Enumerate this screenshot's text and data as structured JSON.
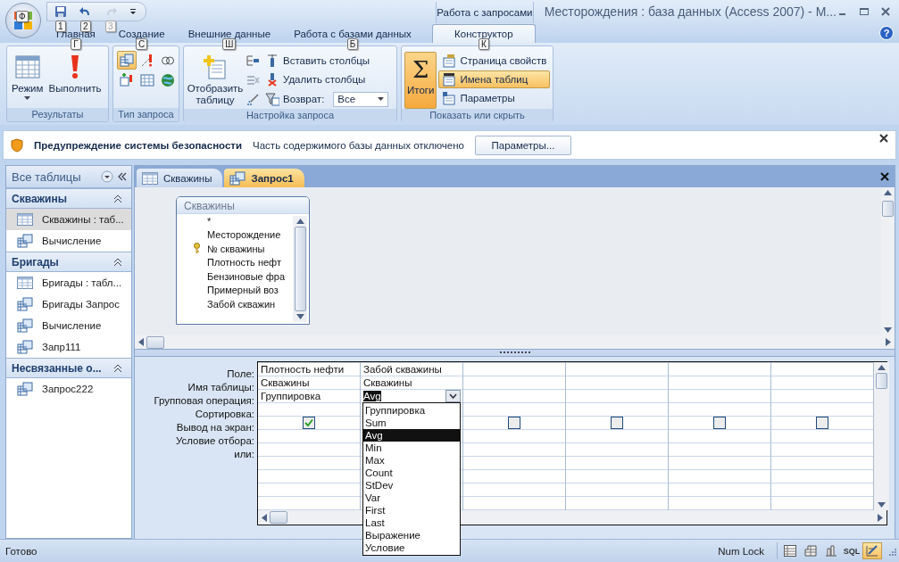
{
  "window": {
    "title": "Месторождения : база данных (Access 2007) - M...",
    "context_tab": "Работа с запросами",
    "help": "?"
  },
  "office_button": {
    "keytip": "Ф"
  },
  "quick_access": [
    {
      "keytip": "1",
      "disabled": false
    },
    {
      "keytip": "2",
      "disabled": false
    },
    {
      "keytip": "3",
      "disabled": true
    }
  ],
  "ribbon_tabs": [
    {
      "label": "Главная",
      "keytip": "Г",
      "selected": false
    },
    {
      "label": "Создание",
      "keytip": "С",
      "selected": false
    },
    {
      "label": "Внешние данные",
      "keytip": "Ш",
      "selected": false
    },
    {
      "label": "Работа с базами данных",
      "keytip": "Б",
      "selected": false
    },
    {
      "label": "Конструктор",
      "keytip": "К",
      "selected": true
    }
  ],
  "ribbon": {
    "results": {
      "label": "Результаты",
      "view": "Режим",
      "run": "Выполнить"
    },
    "query_type": {
      "label": "Тип запроса",
      "buttons": [
        {
          "selected": true
        },
        {
          "selected": false
        },
        {
          "selected": false
        },
        {
          "selected": false
        },
        {
          "selected": false
        },
        {
          "selected": false
        }
      ]
    },
    "query_setup": {
      "label": "Настройка запроса",
      "show_table": "Отобразить таблицу",
      "insert_columns": "Вставить столбцы",
      "delete_columns": "Удалить столбцы",
      "return_label": "Возврат:",
      "return_value": "Все"
    },
    "show_hide": {
      "label": "Показать или скрыть",
      "totals": {
        "symbol": "Σ",
        "label": "Итоги",
        "selected": true
      },
      "items": [
        {
          "label": "Страница свойств",
          "selected": false
        },
        {
          "label": "Имена таблиц",
          "selected": true
        },
        {
          "label": "Параметры",
          "selected": false
        }
      ]
    }
  },
  "security_bar": {
    "title": "Предупреждение системы безопасности",
    "message": "Часть содержимого базы данных отключено",
    "button": "Параметры..."
  },
  "navigation": {
    "header": "Все таблицы",
    "groups": [
      {
        "label": "Скважины",
        "items": [
          {
            "label": "Скважины : таб...",
            "kind": "table",
            "selected": true
          },
          {
            "label": "Вычисление",
            "kind": "query",
            "selected": false
          }
        ]
      },
      {
        "label": "Бригады",
        "items": [
          {
            "label": "Бригады : табл...",
            "kind": "table",
            "selected": false
          },
          {
            "label": "Бригады Запрос",
            "kind": "query",
            "selected": false
          },
          {
            "label": "Вычисление",
            "kind": "query",
            "selected": false
          },
          {
            "label": "Запр111",
            "kind": "query",
            "selected": false
          }
        ]
      },
      {
        "label": "Несвязанные о...",
        "items": [
          {
            "label": "Запрос222",
            "kind": "query",
            "selected": false
          }
        ]
      }
    ]
  },
  "document_tabs": [
    {
      "label": "Скважины",
      "kind": "table",
      "selected": false
    },
    {
      "label": "Запрос1",
      "kind": "query",
      "selected": true
    }
  ],
  "table_box": {
    "title": "Скважины",
    "fields": [
      {
        "label": "*",
        "key": false
      },
      {
        "label": "Месторождение",
        "key": false
      },
      {
        "label": "№ скважины",
        "key": true
      },
      {
        "label": "Плотность нефт",
        "key": false
      },
      {
        "label": "Бензиновые фра",
        "key": false
      },
      {
        "label": "Примерный воз",
        "key": false
      },
      {
        "label": "Забой скважин",
        "key": false
      }
    ]
  },
  "grid": {
    "row_labels": [
      "Поле:",
      "Имя таблицы:",
      "Групповая операция:",
      "Сортировка:",
      "Вывод на экран:",
      "Условие отбора:",
      "или:"
    ],
    "columns": [
      {
        "field": "Плотность нефти",
        "table": "Скважины",
        "total": "Группировка",
        "show": true
      },
      {
        "field": "Забой скважины",
        "table": "Скважины",
        "total": "Avg",
        "total_options": [
          {
            "label": "Группировка",
            "selected": false
          },
          {
            "label": "Sum",
            "selected": false
          },
          {
            "label": "Avg",
            "selected": true
          },
          {
            "label": "Min",
            "selected": false
          },
          {
            "label": "Max",
            "selected": false
          },
          {
            "label": "Count",
            "selected": false
          },
          {
            "label": "StDev",
            "selected": false
          },
          {
            "label": "Var",
            "selected": false
          },
          {
            "label": "First",
            "selected": false
          },
          {
            "label": "Last",
            "selected": false
          },
          {
            "label": "Выражение",
            "selected": false
          },
          {
            "label": "Условие",
            "selected": false
          }
        ]
      },
      {
        "show": false
      },
      {
        "show": false
      },
      {
        "show": false
      },
      {
        "show": false
      }
    ]
  },
  "status_bar": {
    "status": "Готово",
    "num_lock": "Num Lock",
    "views": [
      {
        "kind": "datasheet",
        "selected": false
      },
      {
        "kind": "pivot_table",
        "selected": false
      },
      {
        "kind": "pivot_chart",
        "selected": false
      },
      {
        "kind": "sql",
        "label": "SQL",
        "selected": false
      },
      {
        "kind": "design",
        "selected": true
      }
    ]
  }
}
